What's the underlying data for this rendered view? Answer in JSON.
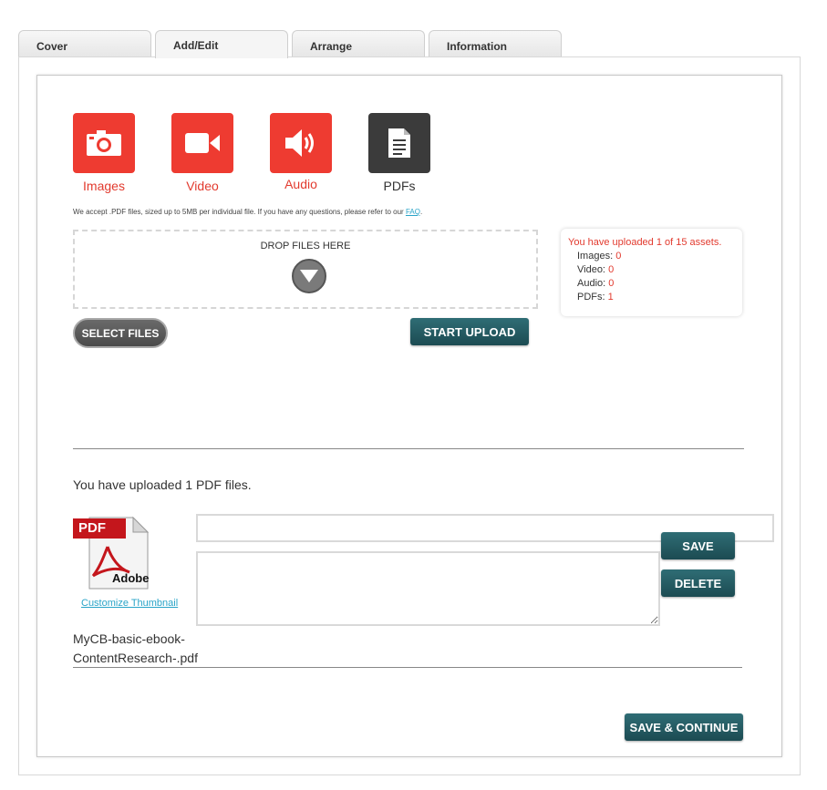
{
  "tabs": [
    {
      "label": "Cover",
      "active": false
    },
    {
      "label": "Add/Edit",
      "active": true
    },
    {
      "label": "Arrange",
      "active": false
    },
    {
      "label": "Information",
      "active": false
    }
  ],
  "media_types": [
    {
      "label": "Images",
      "icon": "camera-icon",
      "color": "#ee3b31"
    },
    {
      "label": "Video",
      "icon": "video-camera-icon",
      "color": "#ee3b31"
    },
    {
      "label": "Audio",
      "icon": "speaker-icon",
      "color": "#ee3b31"
    },
    {
      "label": "PDFs",
      "icon": "document-icon",
      "color": "#3b3b3b"
    }
  ],
  "note": {
    "text": "We accept .PDF files, sized up to 5MB per individual file. If you have any questions, please refer to our ",
    "link": "FAQ",
    "suffix": "."
  },
  "dropzone": {
    "label": "DROP FILES HERE",
    "icon": "arrow-down-icon"
  },
  "stats": {
    "headline": "You have uploaded 1 of 15 assets.",
    "rows": [
      {
        "label": "Images:",
        "value": "0"
      },
      {
        "label": "Video:",
        "value": "0"
      },
      {
        "label": "Audio:",
        "value": "0"
      },
      {
        "label": "PDFs:",
        "value": "1"
      }
    ]
  },
  "buttons": {
    "select_files": "SELECT FILES",
    "start_upload": "START UPLOAD",
    "save": "SAVE",
    "delete": "DELETE",
    "save_continue": "SAVE & CONTINUE"
  },
  "uploaded_summary": "You have uploaded 1 PDF files.",
  "file": {
    "thumb_badge": "PDF",
    "thumb_brand": "Adobe",
    "customize_link": "Customize Thumbnail",
    "title_value": "",
    "description_value": "",
    "name_line1": "MyCB-basic-ebook-",
    "name_line2": "ContentResearch-.pdf"
  },
  "colors": {
    "accent_red": "#e23a2e",
    "teal": "#1f5158",
    "link": "#2aa4c8"
  }
}
